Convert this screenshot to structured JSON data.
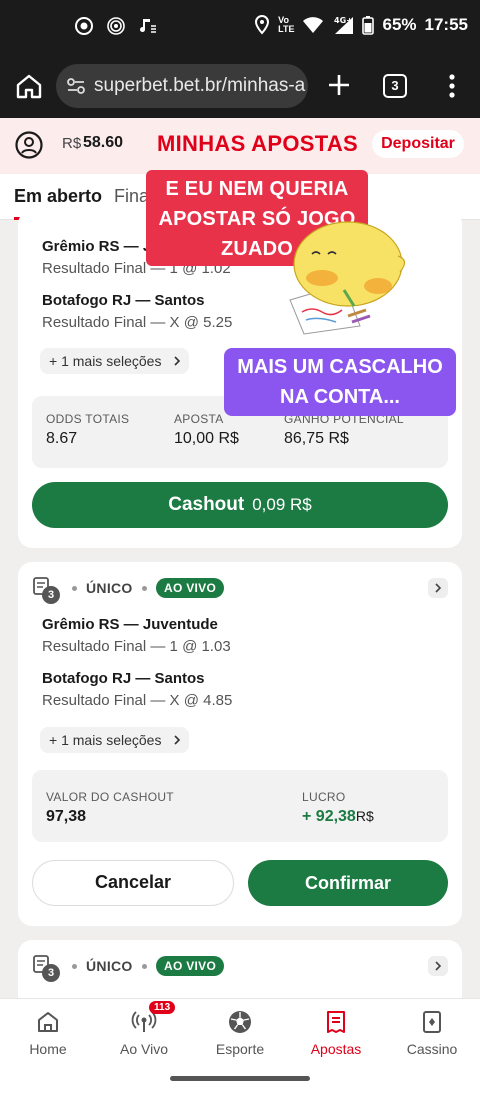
{
  "status_bar": {
    "battery": "65%",
    "time": "17:55",
    "network": "4G+"
  },
  "browser": {
    "url": "superbet.bet.br/minhas-a",
    "tab_count": "3"
  },
  "header": {
    "currency": "R$",
    "balance": "58.60",
    "title": "MINHAS APOSTAS",
    "deposit_label": "Depositar"
  },
  "tabs": {
    "active": "Em aberto",
    "other": "Fina"
  },
  "bet1": {
    "selections": [
      {
        "match": "Grêmio RS — Juventude",
        "market": "Resultado Final — 1 @ 1.02"
      },
      {
        "match": "Botafogo RJ — Santos",
        "market": "Resultado Final — X @ 5.25"
      }
    ],
    "more_label": "+ 1 mais seleções",
    "odds_label": "ODDS TOTAIS",
    "odds_value": "8.67",
    "stake_label": "APOSTA",
    "stake_value": "10,00",
    "stake_currency": "R$",
    "potential_label": "GANHO POTENCIAL",
    "potential_value": "86,75",
    "potential_currency": "R$",
    "cashout_label": "Cashout",
    "cashout_amount": "0,09 R$"
  },
  "bet2": {
    "count": "3",
    "type": "ÚNICO",
    "live_label": "AO VIVO",
    "selections": [
      {
        "match": "Grêmio RS — Juventude",
        "market": "Resultado Final — 1 @ 1.03"
      },
      {
        "match": "Botafogo RJ — Santos",
        "market": "Resultado Final — X @ 4.85"
      }
    ],
    "more_label": "+ 1 mais seleções",
    "cashout_value_label": "VALOR DO CASHOUT",
    "cashout_value": "97,38",
    "profit_label": "LUCRO",
    "profit_value": "+ 92,38",
    "profit_currency": "R$",
    "cancel_label": "Cancelar",
    "confirm_label": "Confirmar"
  },
  "bet3": {
    "count": "3",
    "type": "ÚNICO",
    "live_label": "AO VIVO"
  },
  "overlay": {
    "red_lines": [
      "E EU NEM QUERIA",
      "APOSTAR SÓ JOGO",
      "ZUADO"
    ],
    "purple_lines": [
      "MAIS UM CASCALHO",
      "NA CONTA..."
    ]
  },
  "nav": {
    "items": [
      {
        "label": "Home",
        "icon": "home-icon"
      },
      {
        "label": "Ao Vivo",
        "icon": "live-icon",
        "badge": "113"
      },
      {
        "label": "Esporte",
        "icon": "soccer-ball-icon"
      },
      {
        "label": "Apostas",
        "icon": "bet-slip-icon"
      },
      {
        "label": "Cassino",
        "icon": "cards-icon"
      }
    ]
  },
  "colors": {
    "brand_red": "#e00019",
    "success_green": "#1c7a43",
    "sticker_red": "#e8324a",
    "sticker_purple": "#8b55f0"
  }
}
